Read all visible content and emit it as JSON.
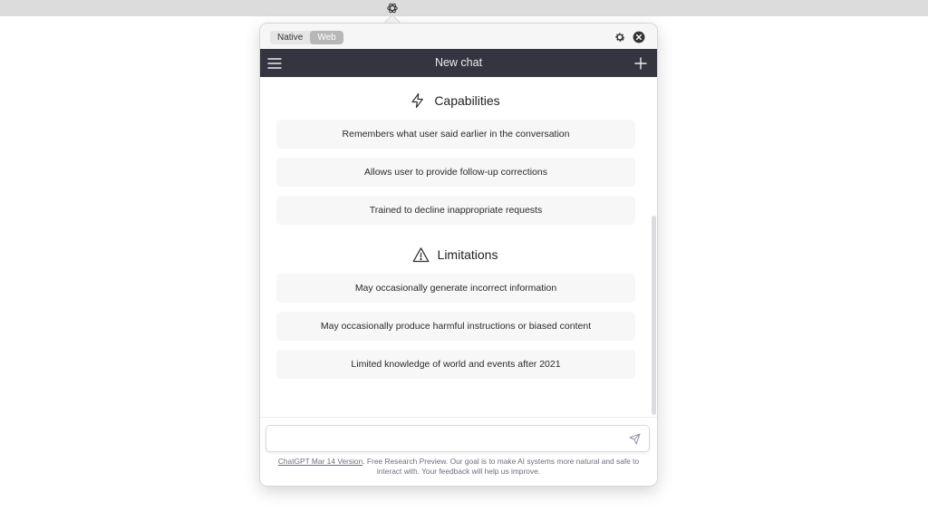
{
  "popover": {
    "mode_tabs": [
      {
        "label": "Native",
        "active": false
      },
      {
        "label": "Web",
        "active": true
      }
    ]
  },
  "navbar": {
    "title": "New chat"
  },
  "capabilities": {
    "heading": "Capabilities",
    "icon": "lightning-icon",
    "items": [
      "Remembers what user said earlier in the conversation",
      "Allows user to provide follow-up corrections",
      "Trained to decline inappropriate requests"
    ]
  },
  "limitations": {
    "heading": "Limitations",
    "icon": "warning-triangle-icon",
    "items": [
      "May occasionally generate incorrect information",
      "May occasionally produce harmful instructions or biased content",
      "Limited knowledge of world and events after 2021"
    ]
  },
  "composer": {
    "value": "",
    "placeholder": ""
  },
  "footer": {
    "version_link": "ChatGPT Mar 14 Version",
    "disclaimer": ". Free Research Preview. Our goal is to make AI systems more natural and safe to interact with. Your feedback will help us improve."
  },
  "colors": {
    "navbar_bg": "#343541",
    "card_bg": "#f7f7f8",
    "segment_active": "#b7b7b7"
  }
}
